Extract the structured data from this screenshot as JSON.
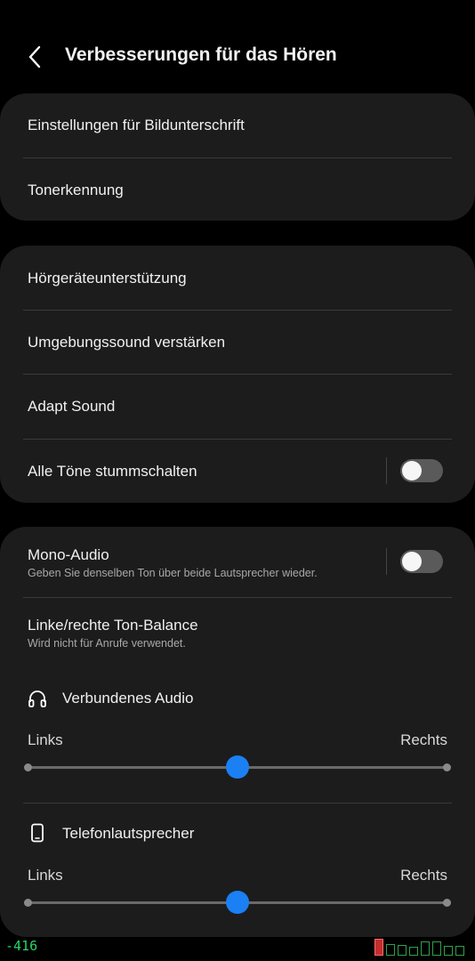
{
  "header": {
    "title": "Verbesserungen für das Hören"
  },
  "group1": {
    "items": [
      {
        "label": "Einstellungen für Bildunterschrift"
      },
      {
        "label": "Tonerkennung"
      }
    ]
  },
  "group2": {
    "items": [
      {
        "label": "Hörgeräteunterstützung"
      },
      {
        "label": "Umgebungssound verstärken"
      },
      {
        "label": "Adapt Sound"
      },
      {
        "label": "Alle Töne stummschalten",
        "toggle": false
      }
    ]
  },
  "group3": {
    "mono": {
      "label": "Mono-Audio",
      "sub": "Geben Sie denselben Ton über beide Lautsprecher wieder.",
      "toggle": false
    },
    "balance": {
      "label": "Linke/rechte Ton-Balance",
      "sub": "Wird nicht für Anrufe verwendet."
    },
    "connected": {
      "label": "Verbundenes Audio",
      "icon": "headphones-icon",
      "left": "Links",
      "right": "Rechts",
      "value": 0.5
    },
    "phone": {
      "label": "Telefonlautsprecher",
      "icon": "phone-icon",
      "left": "Links",
      "right": "Rechts",
      "value": 0.5
    }
  },
  "debug": {
    "value": "-416"
  },
  "colors": {
    "accent": "#1a80f4",
    "card": "#1c1c1c",
    "background": "#000000"
  }
}
